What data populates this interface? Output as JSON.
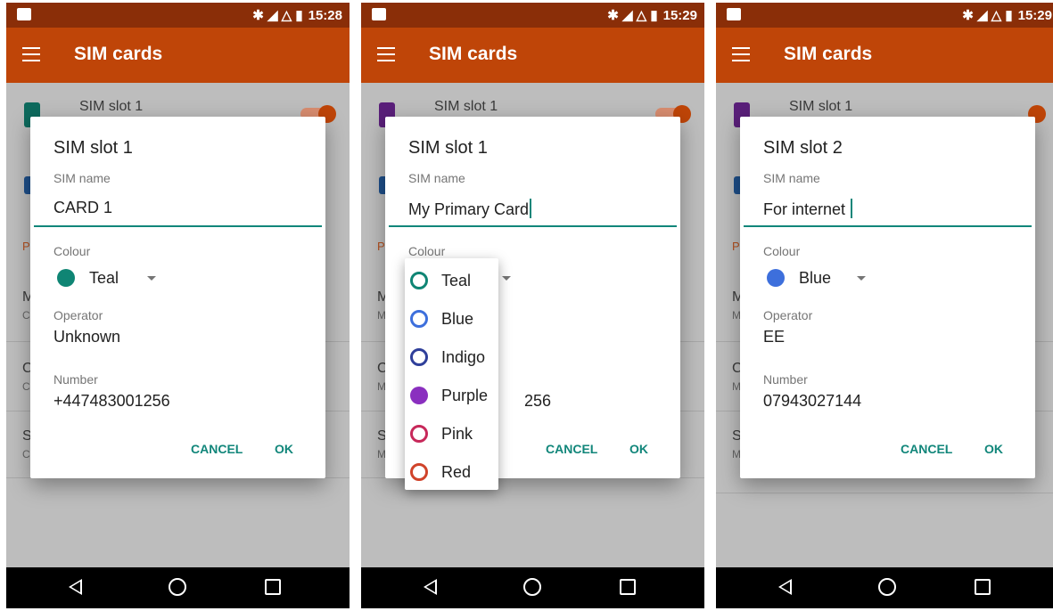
{
  "app_title": "SIM cards",
  "background": {
    "first_row_title": "SIM slot 1",
    "section_letter": "P",
    "row_letters": [
      "M",
      "C",
      "S"
    ],
    "row_sub_letters_1": [
      "C",
      "C",
      "C"
    ],
    "row_sub_letters_2": [
      "M",
      "M",
      "M"
    ]
  },
  "screens": [
    {
      "time": "15:28",
      "status_icons": "✱ ◢ △ ▮",
      "dialog": {
        "title": "SIM slot 1",
        "sim_name_label": "SIM name",
        "sim_name_value": "CARD 1",
        "colour_label": "Colour",
        "colour_value": "Teal",
        "colour_hex": "#0f8574",
        "operator_label": "Operator",
        "operator_value": "Unknown",
        "number_label": "Number",
        "number_value": "+447483001256",
        "cancel_label": "CANCEL",
        "ok_label": "OK"
      }
    },
    {
      "time": "15:29",
      "status_icons": "✱ ◢ △ ▮",
      "dialog": {
        "title": "SIM slot 1",
        "sim_name_label": "SIM name",
        "sim_name_value": "My Primary Card",
        "colour_label": "Colour",
        "number_tail": "256",
        "cancel_label": "CANCEL",
        "ok_label": "OK"
      },
      "dropdown": [
        {
          "label": "Teal",
          "color": "#0f8574",
          "filled": false
        },
        {
          "label": "Blue",
          "color": "#3d6fdc",
          "filled": false
        },
        {
          "label": "Indigo",
          "color": "#2f3f9a",
          "filled": false
        },
        {
          "label": "Purple",
          "color": "#8a2fbf",
          "filled": true
        },
        {
          "label": "Pink",
          "color": "#c7285a",
          "filled": false
        },
        {
          "label": "Red",
          "color": "#d0432a",
          "filled": false
        }
      ]
    },
    {
      "time": "15:29",
      "status_icons": "✱ ◢ △ ▮",
      "dialog": {
        "title": "SIM slot 2",
        "sim_name_label": "SIM name",
        "sim_name_value": "For internet",
        "colour_label": "Colour",
        "colour_value": "Blue",
        "colour_hex": "#3d6fdc",
        "operator_label": "Operator",
        "operator_value": "EE",
        "number_label": "Number",
        "number_value": "07943027144",
        "cancel_label": "CANCEL",
        "ok_label": "OK"
      }
    }
  ]
}
